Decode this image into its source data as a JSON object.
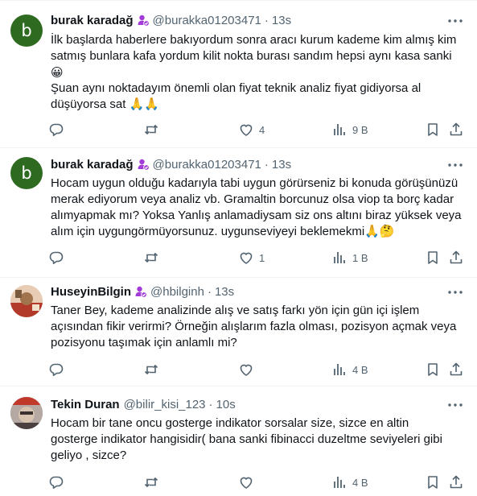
{
  "tweets": [
    {
      "avatar_letter": "b",
      "name": "burak karadağ",
      "handle": "@burakka01203471",
      "time": "13s",
      "lines": [
        "İlk başlarda haberlere bakıyordum sonra aracı kurum kademe kim almış kim",
        "satmış bunlara kafa yordum kilit nokta burası sandım hepsi aynı kasa sanki",
        "😀",
        "Şuan aynı noktadayım önemli olan fiyat teknik analiz fiyat gidiyorsa al",
        "düşüyorsa sat 🙏🙏"
      ],
      "replies": "",
      "retweets": "",
      "likes": "4",
      "views": "9 B"
    },
    {
      "avatar_letter": "b",
      "name": "burak karadağ",
      "handle": "@burakka01203471",
      "time": "13s",
      "lines": [
        "Hocam uygun olduğu kadarıyla tabi uygun görürseniz bi konuda görüşünüzü",
        "merak ediyorum  veya analiz vb. Gramaltin borcunuz olsa viop ta borç kadar",
        "alımyapmak mı? Yoksa Yanlış anlamadiysam siz ons altını biraz yüksek veya",
        "alım için uygungörmüyorsunuz. uygunseviyeyi beklemekmi🙏🤔"
      ],
      "replies": "",
      "retweets": "",
      "likes": "1",
      "views": "1 B"
    },
    {
      "avatar_letter": "",
      "name": "HuseyinBilgin",
      "handle": "@hbilginh",
      "time": "13s",
      "lines": [
        "Taner Bey, kademe analizinde alış ve satış farkı yön için gün içi işlem",
        "açısından fikir verirmi? Örneğin alışlarım fazla olması, pozisyon açmak veya",
        "pozisyonu taşımak için anlamlı mi?"
      ],
      "replies": "",
      "retweets": "",
      "likes": "",
      "views": "4 B"
    },
    {
      "avatar_letter": "",
      "name": "Tekin Duran",
      "handle": "@bilir_kisi_123",
      "time": "10s",
      "lines": [
        "Hocam bir tane oncu gosterge indikator sorsalar size, sizce en altin",
        "gosterge indikator hangisidir( bana sanki fibinacci duzeltme seviyeleri gibi",
        "geliyo , sizce?"
      ],
      "replies": "",
      "retweets": "",
      "likes": "",
      "views": "4 B"
    }
  ],
  "colors": {
    "text": "#0f1419",
    "secondary": "#536471",
    "badge": "#a23bd8",
    "border": "#eff3f4"
  },
  "icons": [
    "reply-icon",
    "retweet-icon",
    "like-icon",
    "views-icon",
    "bookmark-icon",
    "share-icon",
    "more-icon",
    "verified-badge-icon"
  ]
}
